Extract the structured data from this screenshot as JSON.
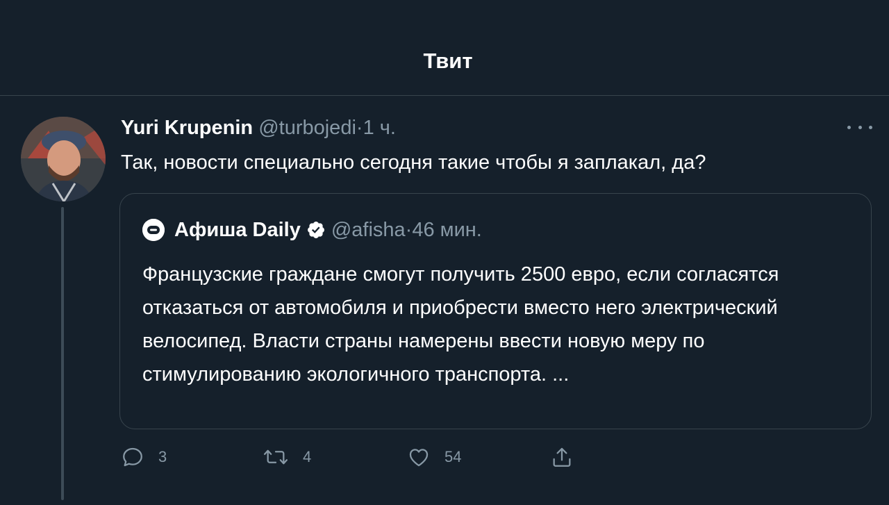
{
  "header": {
    "title": "Твит"
  },
  "tweet": {
    "author_name": "Yuri Krupenin",
    "handle": "@turbojedi",
    "separator": "·",
    "time": "1 ч.",
    "text": "Так, новости специально сегодня такие чтобы я заплакал, да?",
    "avatar_icon": "user-avatar-photo",
    "more_icon": "more-horizontal-icon"
  },
  "quote": {
    "logo_letter": "a",
    "author_name": "Афиша Daily",
    "verified_icon": "verified-badge-icon",
    "handle": "@afisha",
    "separator": "·",
    "time": "46 мин.",
    "text": "Французские граждане смогут получить 2500 евро, если согласятся отказаться от автомобиля и приобрести вместо него электрический велосипед. Власти страны намерены ввести новую меру по стимулированию экологичного транспорта. ..."
  },
  "actions": {
    "replies": "3",
    "retweets": "4",
    "likes": "54",
    "reply_icon": "reply-icon",
    "retweet_icon": "retweet-icon",
    "like_icon": "heart-icon",
    "share_icon": "share-icon"
  },
  "colors": {
    "background": "#15202b",
    "border": "#38444d",
    "muted_text": "#8899a6",
    "text": "#ffffff"
  }
}
